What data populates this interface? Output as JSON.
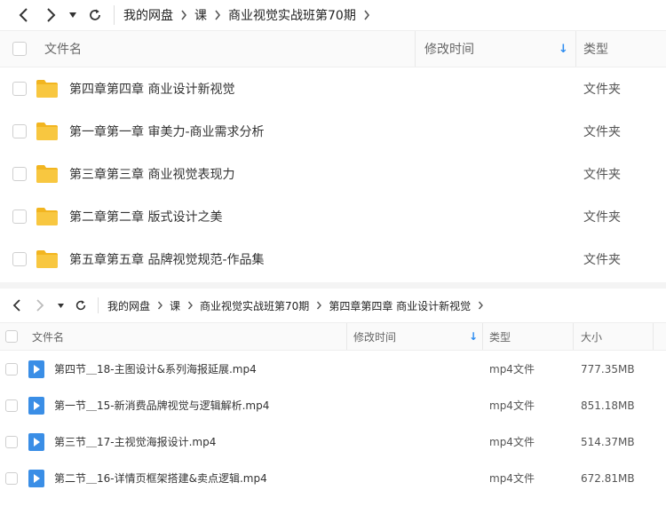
{
  "pane1": {
    "breadcrumbs": [
      "我的网盘",
      "课",
      "商业视觉实战班第70期"
    ],
    "headers": {
      "name": "文件名",
      "modified": "修改时间",
      "type": "类型"
    },
    "rows": [
      {
        "name": "第四章第四章 商业设计新视觉",
        "type": "文件夹"
      },
      {
        "name": "第一章第一章 审美力-商业需求分析",
        "type": "文件夹"
      },
      {
        "name": "第三章第三章 商业视觉表现力",
        "type": "文件夹"
      },
      {
        "name": "第二章第二章 版式设计之美",
        "type": "文件夹"
      },
      {
        "name": "第五章第五章 品牌视觉规范-作品集",
        "type": "文件夹"
      }
    ]
  },
  "pane2": {
    "breadcrumbs": [
      "我的网盘",
      "课",
      "商业视觉实战班第70期",
      "第四章第四章 商业设计新视觉"
    ],
    "headers": {
      "name": "文件名",
      "modified": "修改时间",
      "type": "类型",
      "size": "大小"
    },
    "rows": [
      {
        "name": "第四节＿18-主图设计&系列海报延展.mp4",
        "type": "mp4文件",
        "size": "777.35MB"
      },
      {
        "name": "第一节＿15-新消费品牌视觉与逻辑解析.mp4",
        "type": "mp4文件",
        "size": "851.18MB"
      },
      {
        "name": "第三节＿17-主视觉海报设计.mp4",
        "type": "mp4文件",
        "size": "514.37MB"
      },
      {
        "name": "第二节＿16-详情页框架搭建&卖点逻辑.mp4",
        "type": "mp4文件",
        "size": "672.81MB"
      }
    ]
  },
  "icons": {
    "back": "chevron-left-icon",
    "forward": "chevron-right-icon",
    "history": "caret-down-icon",
    "refresh": "refresh-icon",
    "folder": "folder-icon",
    "video": "video-file-icon",
    "sort": "arrow-down-icon"
  },
  "colors": {
    "accent": "#2c8cf0",
    "folder": "#f8c740",
    "folder_back": "#f2b520",
    "video": "#3a8ee6"
  }
}
